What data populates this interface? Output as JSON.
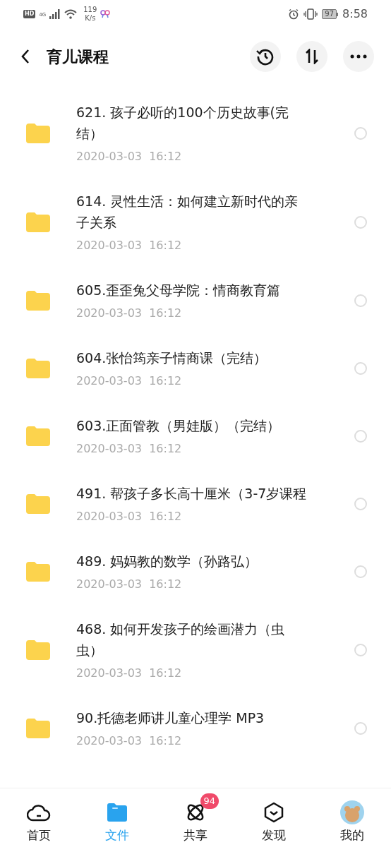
{
  "status_bar": {
    "hd": "HD",
    "network": "4G",
    "speed_value": "119",
    "speed_unit": "K/s",
    "battery": "97",
    "time": "8:58"
  },
  "header": {
    "title": "育儿课程"
  },
  "folders": [
    {
      "name": "621. 孩子必听的100个历史故事(完结）",
      "date": "2020-03-03  16:12",
      "selected": false
    },
    {
      "name": "614. 灵性生活：如何建立新时代的亲子关系",
      "date": "2020-03-03  16:12",
      "selected": false
    },
    {
      "name": "605.歪歪兔父母学院：情商教育篇",
      "date": "2020-03-03  16:12",
      "selected": false
    },
    {
      "name": "604.张怡筠亲子情商课（完结）",
      "date": "2020-03-03  16:12",
      "selected": false
    },
    {
      "name": "603.正面管教（男娃版）（完结）",
      "date": "2020-03-03  16:12",
      "selected": false
    },
    {
      "name": "491. 帮孩子多长高十厘米（3-7岁课程",
      "date": "2020-03-03  16:12",
      "selected": false
    },
    {
      "name": "489. 妈妈教的数学（孙路弘）",
      "date": "2020-03-03  16:12",
      "selected": false
    },
    {
      "name": "468. 如何开发孩子的绘画潜力（虫虫）",
      "date": "2020-03-03  16:12",
      "selected": false
    },
    {
      "name": "90.托德老师讲儿童心理学 MP3",
      "date": "2020-03-03  16:12",
      "selected": false
    }
  ],
  "tab_bar": [
    {
      "kind": "home",
      "label": "首页",
      "selected": false
    },
    {
      "kind": "files",
      "label": "文件",
      "selected": true
    },
    {
      "kind": "share",
      "label": "共享",
      "selected": false,
      "badge": "94"
    },
    {
      "kind": "discover",
      "label": "发现",
      "selected": false
    },
    {
      "kind": "me",
      "label": "我的",
      "selected": false
    }
  ]
}
